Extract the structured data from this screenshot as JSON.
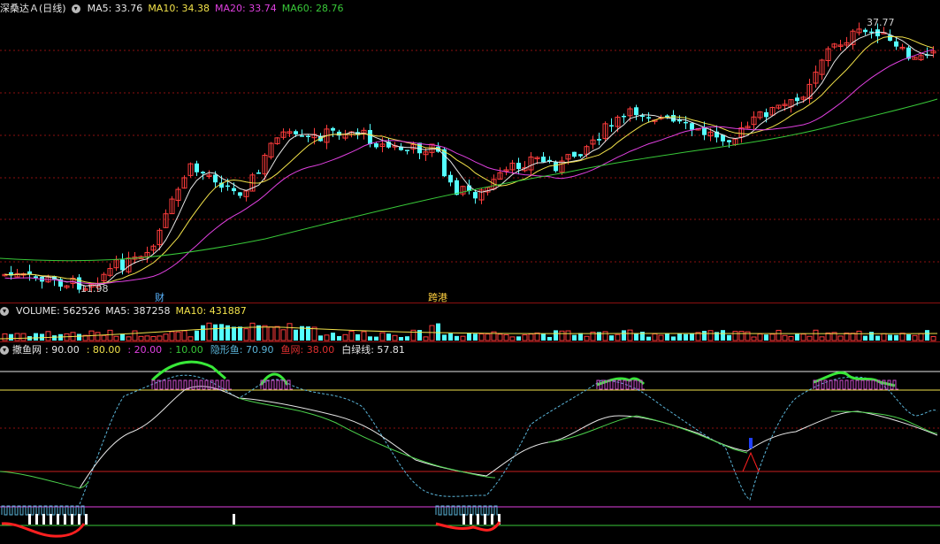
{
  "main_panel": {
    "title": "深桑达Ａ(日线)",
    "indicators": [
      {
        "label": "MA5: 33.76",
        "color": "#e6e6e6"
      },
      {
        "label": "MA10: 34.38",
        "color": "#f2e24a"
      },
      {
        "label": "MA20: 33.74",
        "color": "#e040e0"
      },
      {
        "label": "MA60: 28.76",
        "color": "#38c838"
      }
    ],
    "annotations": {
      "high": "37.77",
      "low": "11.98",
      "marker_fin": "财",
      "marker_cross": "跨港"
    }
  },
  "volume_panel": {
    "indicators": [
      {
        "label": "VOLUME: 562526",
        "color": "#e6e6e6"
      },
      {
        "label": "MA5: 387258",
        "color": "#e6e6e6"
      },
      {
        "label": "MA10: 431887",
        "color": "#f2e24a"
      }
    ]
  },
  "indicator_panel": {
    "name": "撒鱼网",
    "values": [
      {
        "label": ": 90.00",
        "color": "#e6e6e6"
      },
      {
        "label": ": 80.00",
        "color": "#f2e24a"
      },
      {
        "label": ": 20.00",
        "color": "#e040e0"
      },
      {
        "label": ": 10.00",
        "color": "#38c838"
      },
      {
        "label": "隐形鱼: 70.90",
        "color": "#5ab4d8"
      },
      {
        "label": "鱼网: 38.00",
        "color": "#e03030"
      },
      {
        "label": "白绿线: 57.81",
        "color": "#e6e6e6"
      }
    ]
  },
  "colors": {
    "up": "#ff3c3c",
    "down": "#54ffff",
    "ma5": "#e6e6e6",
    "ma10": "#f2e24a",
    "ma20": "#e040e0",
    "ma60": "#38c838",
    "grid": "#8c1010"
  }
}
